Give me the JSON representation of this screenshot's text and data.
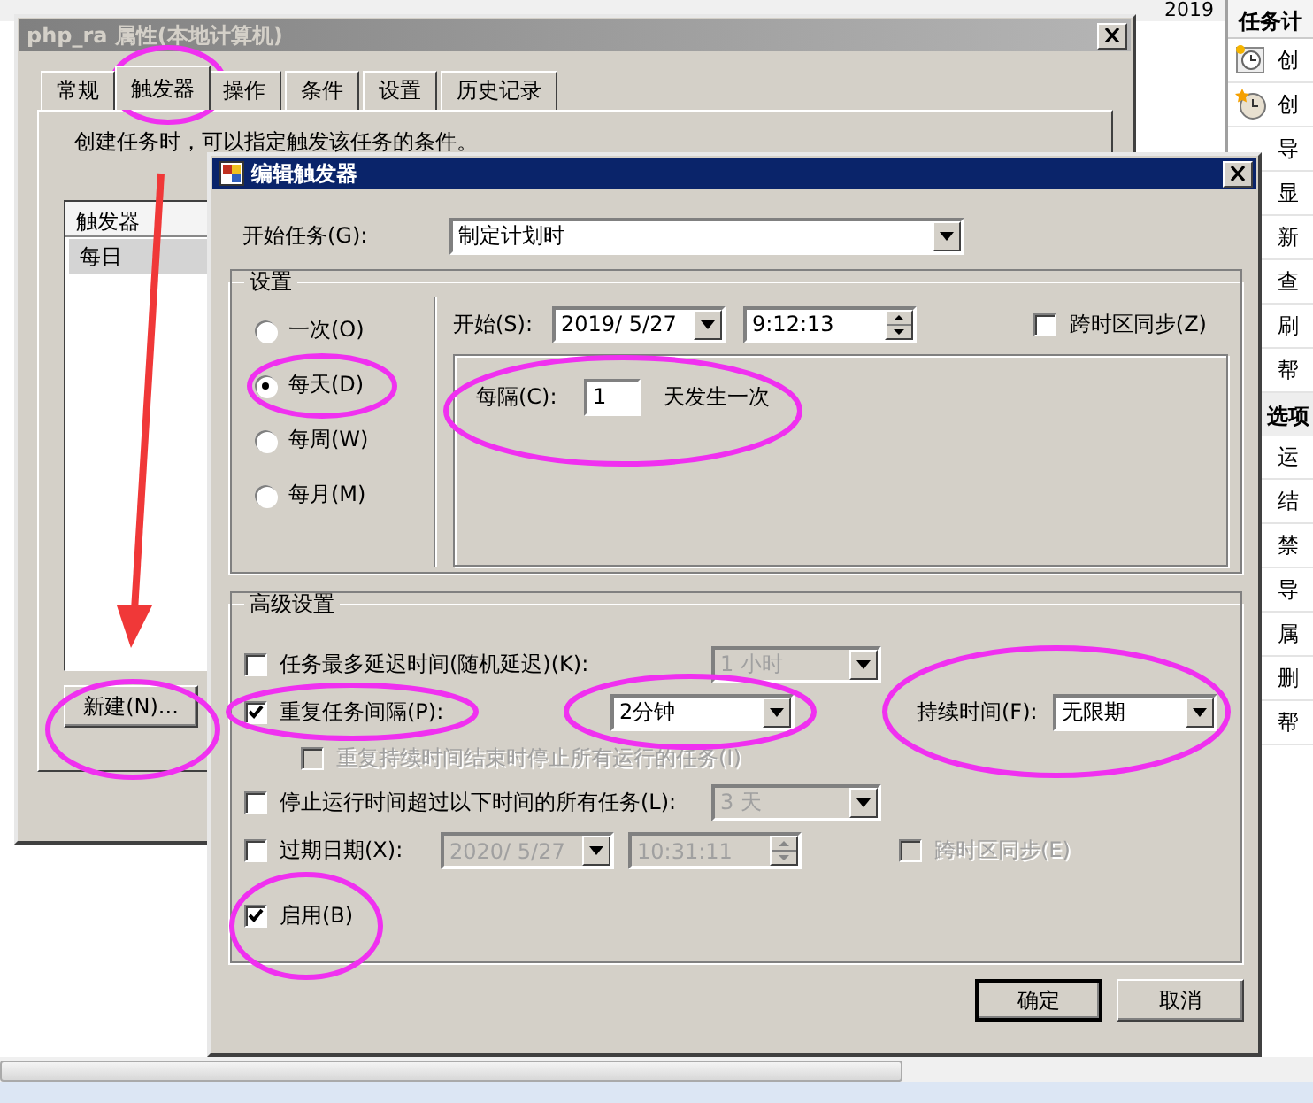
{
  "background": {
    "year": "2019"
  },
  "side_panel": {
    "title": "任务计",
    "sections": [
      {
        "items": [
          {
            "kind": "clock",
            "label": "创"
          },
          {
            "kind": "clock-star",
            "label": "创"
          },
          {
            "kind": "plain",
            "label": "导"
          },
          {
            "kind": "plain",
            "label": "显"
          },
          {
            "kind": "plain",
            "label": "新"
          },
          {
            "kind": "plain",
            "label": "查"
          },
          {
            "kind": "plain",
            "label": "刷"
          },
          {
            "kind": "plain",
            "label": "帮"
          }
        ]
      },
      {
        "title": "选项",
        "items": [
          {
            "kind": "plain",
            "label": "运"
          },
          {
            "kind": "plain",
            "label": "结"
          },
          {
            "kind": "plain",
            "label": "禁"
          },
          {
            "kind": "plain",
            "label": "导"
          },
          {
            "kind": "plain",
            "label": "属"
          },
          {
            "kind": "plain",
            "label": "删"
          },
          {
            "kind": "plain",
            "label": "帮"
          }
        ]
      }
    ]
  },
  "properties_window": {
    "title": "php_ra 属性(本地计算机)",
    "tabs": [
      {
        "label": "常规",
        "selected": false
      },
      {
        "label": "触发器",
        "selected": true
      },
      {
        "label": "操作",
        "selected": false
      },
      {
        "label": "条件",
        "selected": false
      },
      {
        "label": "设置",
        "selected": false
      },
      {
        "label": "历史记录",
        "selected": false
      }
    ],
    "description": "创建任务时，可以指定触发该任务的条件。",
    "trigger_list": {
      "columns": [
        "触发器"
      ],
      "rows": [
        {
          "cells": [
            "每日"
          ],
          "selected": true
        }
      ]
    },
    "new_button": "新建(N)..."
  },
  "trigger_dialog": {
    "title": "编辑触发器",
    "begin_task": {
      "label": "开始任务(G):",
      "value": "制定计划时"
    },
    "settings": {
      "title": "设置",
      "schedule": [
        {
          "label": "一次(O)",
          "selected": false
        },
        {
          "label": "每天(D)",
          "selected": true
        },
        {
          "label": "每周(W)",
          "selected": false
        },
        {
          "label": "每月(M)",
          "selected": false
        }
      ],
      "start": {
        "label": "开始(S):",
        "date": "2019/ 5/27",
        "time": "9:12:13"
      },
      "sync": {
        "label": "跨时区同步(Z)",
        "checked": false
      },
      "recur": {
        "label": "每隔(C):",
        "value": "1",
        "suffix": "天发生一次"
      }
    },
    "advanced": {
      "title": "高级设置",
      "delay": {
        "label": "任务最多延迟时间(随机延迟)(K):",
        "checked": false,
        "value": "1 小时",
        "value_disabled": true
      },
      "repeat": {
        "label": "重复任务间隔(P):",
        "checked": true,
        "value": "2分钟",
        "value_disabled": false,
        "duration_label": "持续时间(F):",
        "duration": "无限期"
      },
      "stop_at_end": {
        "label": "重复持续时间结束时停止所有运行的任务(I)",
        "checked": false,
        "disabled": true
      },
      "stop": {
        "label": "停止运行时间超过以下时间的所有任务(L):",
        "checked": false,
        "value": "3 天",
        "value_disabled": true
      },
      "expire": {
        "label": "过期日期(X):",
        "checked": false,
        "date": "2020/ 5/27",
        "time": "10:31:11",
        "fields_disabled": true,
        "sync_label": "跨时区同步(E)",
        "sync_checked": false,
        "sync_disabled": true
      },
      "enabled": {
        "label": "启用(B)",
        "checked": true
      }
    },
    "buttons": [
      {
        "label": "确定",
        "default": true
      },
      {
        "label": "取消",
        "default": false
      }
    ]
  }
}
